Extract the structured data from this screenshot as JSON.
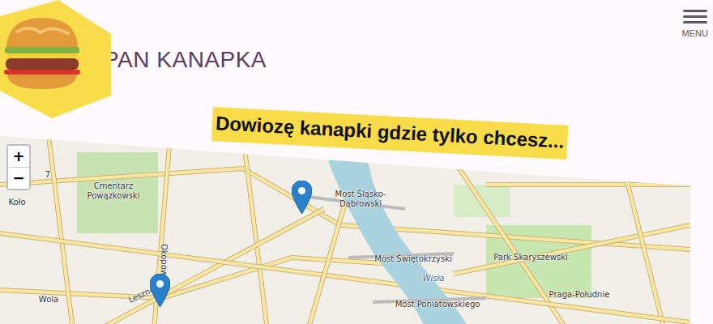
{
  "header": {
    "title": "PAN KANAPKA",
    "menu": {
      "label": "MENU"
    }
  },
  "tagline": "Dowiozę kanapki gdzie tylko chcesz...",
  "map": {
    "zoom": {
      "in": "+",
      "out": "−"
    },
    "labels": [
      "Cmentarz Powązkowski",
      "Wola",
      "Most Śląsko-Dąbrowski",
      "Most Świętokrzyski",
      "Park Skaryszewski",
      "Praga-Południe",
      "Most Poniatowskiego",
      "Wisła",
      "Leszno",
      "Okopowa",
      "Koło",
      "7"
    ],
    "pins": [
      {
        "selected": false
      },
      {
        "selected": false
      }
    ]
  }
}
